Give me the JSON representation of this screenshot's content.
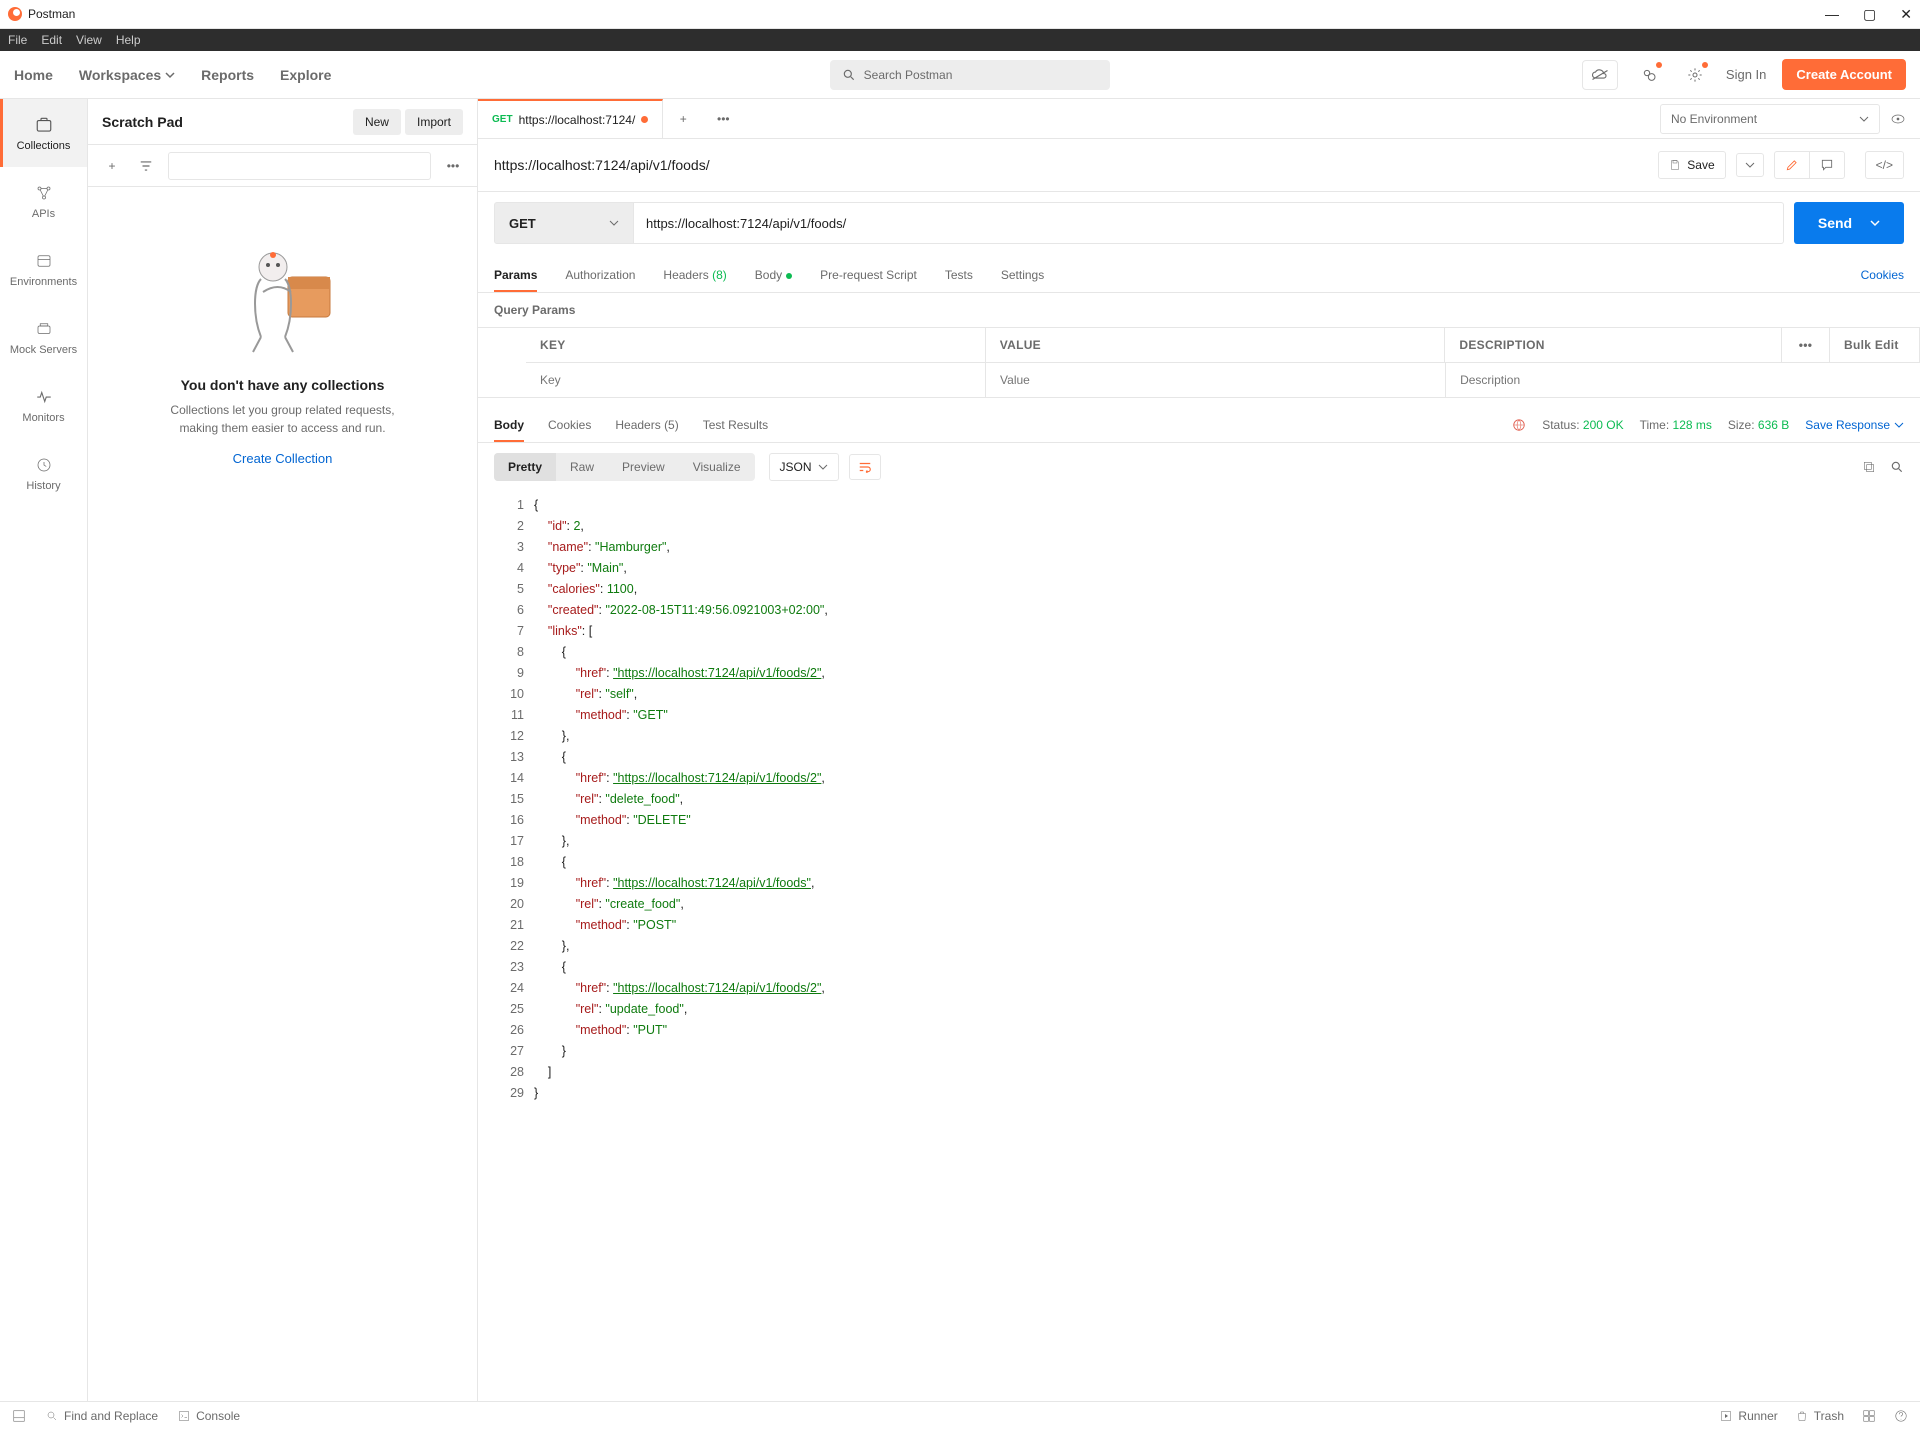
{
  "app": {
    "name": "Postman"
  },
  "menu": {
    "file": "File",
    "edit": "Edit",
    "view": "View",
    "help": "Help"
  },
  "nav": {
    "home": "Home",
    "workspaces": "Workspaces",
    "reports": "Reports",
    "explore": "Explore",
    "search_placeholder": "Search Postman"
  },
  "account": {
    "signin": "Sign In",
    "create": "Create Account"
  },
  "sidebar": {
    "title": "Scratch Pad",
    "new": "New",
    "import": "Import",
    "rail": {
      "collections": "Collections",
      "apis": "APIs",
      "environments": "Environments",
      "mock": "Mock Servers",
      "monitors": "Monitors",
      "history": "History"
    },
    "empty": {
      "title": "You don't have any collections",
      "text1": "Collections let you group related requests,",
      "text2": "making them easier to access and run.",
      "link": "Create Collection"
    }
  },
  "tabs": {
    "env_none": "No Environment",
    "active": {
      "method": "GET",
      "label": "https://localhost:7124/"
    }
  },
  "request": {
    "name": "https://localhost:7124/api/v1/foods/",
    "save": "Save",
    "method": "GET",
    "url": "https://localhost:7124/api/v1/foods/",
    "send": "Send",
    "tabs": {
      "params": "Params",
      "auth": "Authorization",
      "headers": "Headers",
      "headers_n": "(8)",
      "body": "Body",
      "prereq": "Pre-request Script",
      "tests": "Tests",
      "settings": "Settings",
      "cookies": "Cookies"
    },
    "query_title": "Query Params",
    "table": {
      "key": "KEY",
      "value": "VALUE",
      "desc": "DESCRIPTION",
      "bulk": "Bulk Edit",
      "key_ph": "Key",
      "value_ph": "Value",
      "desc_ph": "Description"
    }
  },
  "response": {
    "tabs": {
      "body": "Body",
      "cookies": "Cookies",
      "headers": "Headers",
      "headers_n": "(5)",
      "tests": "Test Results"
    },
    "status_label": "Status:",
    "status": "200 OK",
    "time_label": "Time:",
    "time": "128 ms",
    "size_label": "Size:",
    "size": "636 B",
    "save": "Save Response",
    "views": {
      "pretty": "Pretty",
      "raw": "Raw",
      "preview": "Preview",
      "visualize": "Visualize"
    },
    "lang": "JSON"
  },
  "json_body": {
    "id": 2,
    "name": "Hamburger",
    "type": "Main",
    "calories": 1100,
    "created": "2022-08-15T11:49:56.0921003+02:00",
    "links": [
      {
        "href": "https://localhost:7124/api/v1/foods/2",
        "rel": "self",
        "method": "GET"
      },
      {
        "href": "https://localhost:7124/api/v1/foods/2",
        "rel": "delete_food",
        "method": "DELETE"
      },
      {
        "href": "https://localhost:7124/api/v1/foods",
        "rel": "create_food",
        "method": "POST"
      },
      {
        "href": "https://localhost:7124/api/v1/foods/2",
        "rel": "update_food",
        "method": "PUT"
      }
    ]
  },
  "statusbar": {
    "find": "Find and Replace",
    "console": "Console",
    "runner": "Runner",
    "trash": "Trash"
  }
}
